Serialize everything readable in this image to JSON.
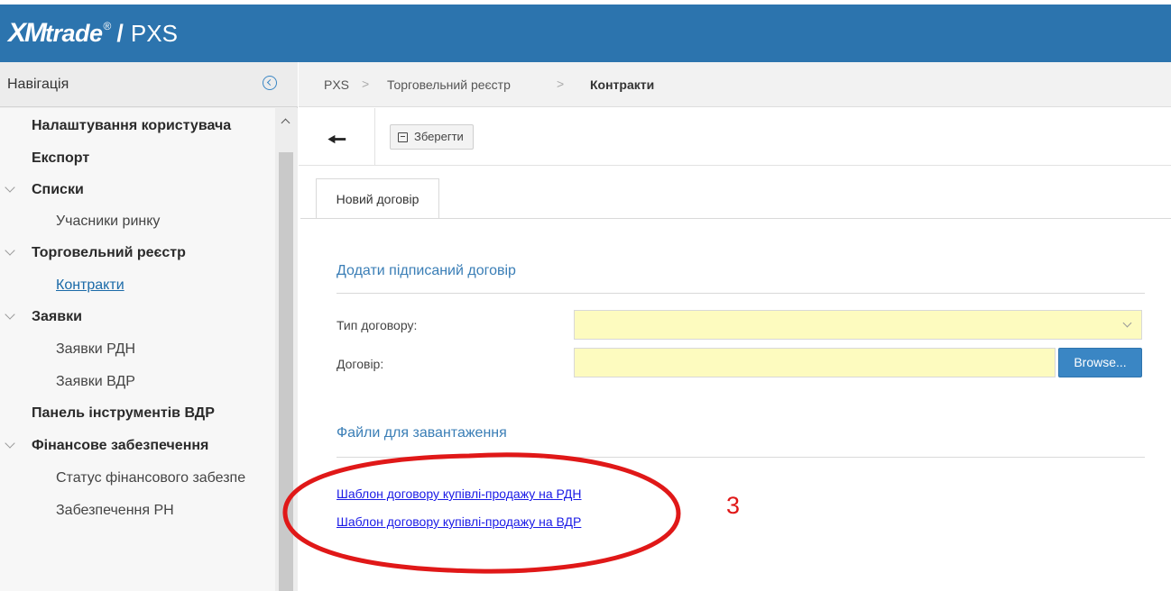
{
  "header": {
    "logo_mark": "XM",
    "logo_word": "trade",
    "logo_reg": "®",
    "separator": "/",
    "app_name": "PXS",
    "bg_color": "#2c74ae"
  },
  "sidebar": {
    "title": "Навігація",
    "collapse_icon": "circle-chevron-left-icon",
    "items": [
      {
        "label": "Налаштування користувача",
        "level": 1,
        "expandable": false
      },
      {
        "label": "Експорт",
        "level": 1,
        "expandable": false
      },
      {
        "label": "Списки",
        "level": 1,
        "expandable": true
      },
      {
        "label": "Учасники ринку",
        "level": 2,
        "active": false
      },
      {
        "label": "Торговельний реєстр",
        "level": 1,
        "expandable": true
      },
      {
        "label": "Контракти",
        "level": 2,
        "active": true
      },
      {
        "label": "Заявки",
        "level": 1,
        "expandable": true
      },
      {
        "label": "Заявки РДН",
        "level": 2,
        "active": false
      },
      {
        "label": "Заявки ВДР",
        "level": 2,
        "active": false
      },
      {
        "label": "Панель інструментів ВДР",
        "level": 1,
        "expandable": false
      },
      {
        "label": "Фінансове забезпечення",
        "level": 1,
        "expandable": true
      },
      {
        "label": "Статус фінансового забезпе",
        "level": 2,
        "active": false
      },
      {
        "label": "Забезпечення РН",
        "level": 2,
        "active": false
      }
    ]
  },
  "breadcrumb": {
    "items": [
      "PXS",
      "Торговельний реєстр",
      "Контракти"
    ],
    "separator": ">"
  },
  "toolbar": {
    "back_icon": "arrow-left-icon",
    "save_icon": "floppy-disk-icon",
    "save_label": "Зберегти"
  },
  "tabs": [
    {
      "label": "Новий договір",
      "active": true
    }
  ],
  "form": {
    "section_title": "Додати підписаний договір",
    "contract_type_label": "Тип договору:",
    "contract_type_value": "",
    "contract_label": "Договір:",
    "contract_value": "",
    "browse_label": "Browse...",
    "field_bg_color": "#fdfbbf"
  },
  "downloads": {
    "section_title": "Файли для завантаження",
    "links": [
      "Шаблон договору купівлі-продажу на РДН",
      "Шаблон договору купівлі-продажу на ВДР"
    ]
  },
  "annotation": {
    "number": "3",
    "color": "#e01818",
    "shape": "ellipse"
  }
}
